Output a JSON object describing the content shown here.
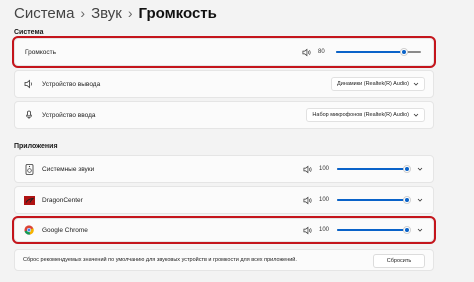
{
  "breadcrumb": {
    "item1": "Система",
    "item2": "Звук",
    "current": "Громкость",
    "separator": "›"
  },
  "system": {
    "label": "Система",
    "volume": {
      "label": "Громкость",
      "value": "80",
      "fraction": 0.8
    },
    "output": {
      "label": "Устройство вывода",
      "selected": "Динамики (Realtek(R) Audio)"
    },
    "input": {
      "label": "Устройство ввода",
      "selected": "Набор микрофонов (Realtek(R) Audio)"
    }
  },
  "apps": {
    "label": "Приложения",
    "items": [
      {
        "name": "Системные звуки",
        "value": "100",
        "fraction": 1.0,
        "icon": "system-sounds-icon"
      },
      {
        "name": "DragonCenter",
        "value": "100",
        "fraction": 1.0,
        "icon": "dragoncenter-icon"
      },
      {
        "name": "Google Chrome",
        "value": "100",
        "fraction": 1.0,
        "icon": "chrome-icon"
      }
    ]
  },
  "reset": {
    "text": "Сброс рекомендуемых значений по умолчанию для звуковых устройств и громкости для всех приложений.",
    "button": "Сбросить"
  },
  "colors": {
    "accent": "#0a63c9",
    "highlight": "#c4151c"
  }
}
